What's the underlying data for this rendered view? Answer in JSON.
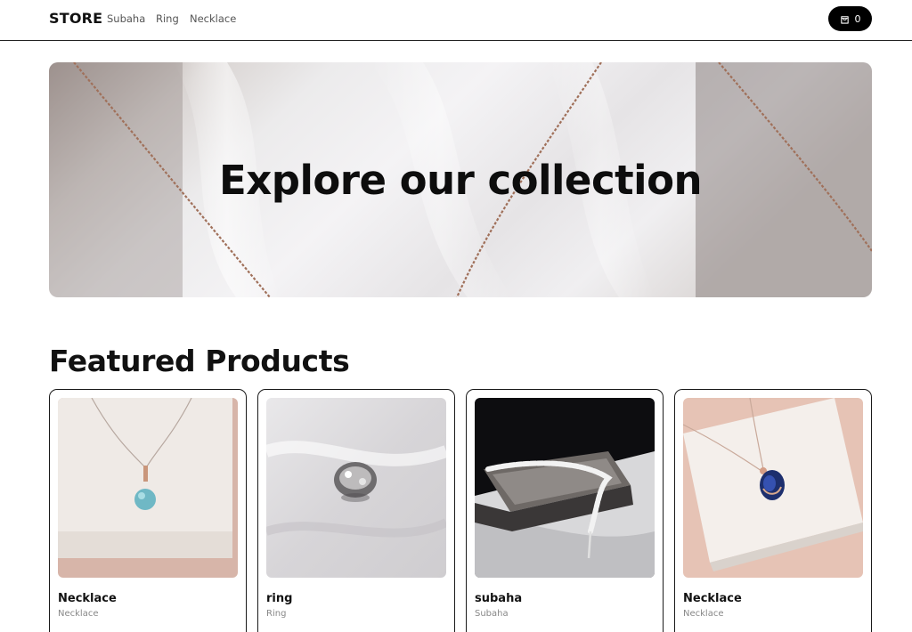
{
  "nav": {
    "brand": "STORE",
    "links": [
      {
        "label": "Subaha"
      },
      {
        "label": "Ring"
      },
      {
        "label": "Necklace"
      }
    ],
    "cart": {
      "count": "0",
      "icon": "shopping-bag-icon"
    }
  },
  "hero": {
    "title": "Explore our collection"
  },
  "featured": {
    "title": "Featured Products",
    "products": [
      {
        "name": "Necklace",
        "category": "Necklace"
      },
      {
        "name": "ring",
        "category": "Ring"
      },
      {
        "name": "subaha",
        "category": "Subaha"
      },
      {
        "name": "Necklace",
        "category": "Necklace"
      }
    ]
  },
  "colors": {
    "accent": "#000000",
    "background": "#ffffff",
    "muted_text": "#888888"
  }
}
